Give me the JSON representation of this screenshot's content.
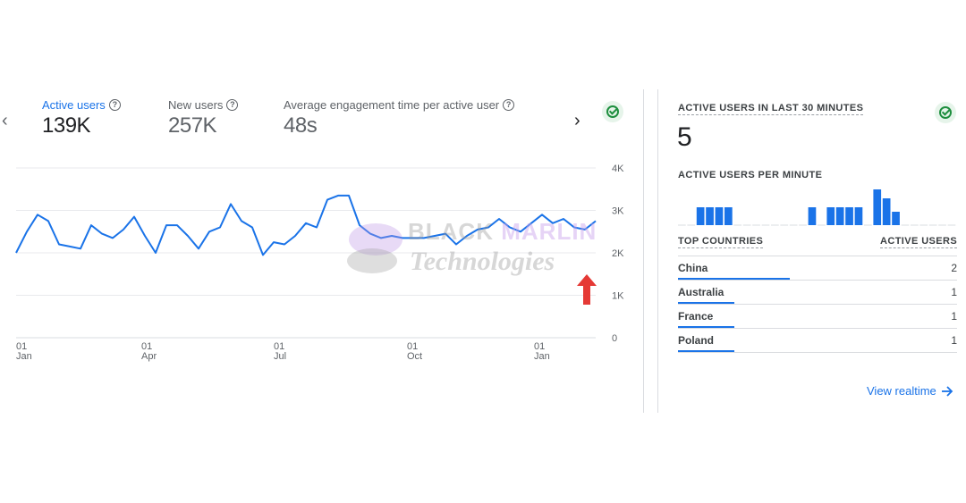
{
  "metrics": [
    {
      "label": "Active users",
      "value": "139K",
      "active": true
    },
    {
      "label": "New users",
      "value": "257K",
      "active": false
    },
    {
      "label": "Average engagement time per active user",
      "value": "48s",
      "active": false
    }
  ],
  "icons": {
    "help": "help-circle-icon",
    "status": "check-circle-icon",
    "prev": "chevron-left-icon",
    "next": "chevron-right-icon",
    "arrow": "arrow-up-icon",
    "link": "arrow-right-icon"
  },
  "colors": {
    "accent": "#1a73e8",
    "success": "#1e8e3e",
    "annotation_arrow": "#e53935"
  },
  "chart_data": {
    "type": "line",
    "y_ticks": [
      "4K",
      "3K",
      "2K",
      "1K",
      "0"
    ],
    "ylim": [
      0,
      4000
    ],
    "x_ticks": [
      {
        "day": "01",
        "month": "Jan"
      },
      {
        "day": "01",
        "month": "Apr"
      },
      {
        "day": "01",
        "month": "Jul"
      },
      {
        "day": "01",
        "month": "Oct"
      },
      {
        "day": "01",
        "month": "Jan"
      }
    ],
    "grid": true,
    "series": [
      {
        "values": [
          2000,
          2500,
          2900,
          2750,
          2200,
          2150,
          2100,
          2650,
          2450,
          2350,
          2550,
          2850,
          2400,
          2000,
          2650,
          2650,
          2400,
          2100,
          2500,
          2600,
          3150,
          2750,
          2600,
          1950,
          2250,
          2200,
          2400,
          2700,
          2600,
          3250,
          3350,
          3350,
          2650,
          2450,
          2350,
          2400,
          2350,
          2350,
          2350,
          2400,
          2450,
          2200,
          2400,
          2550,
          2600,
          2800,
          2600,
          2500,
          2700,
          2900,
          2700,
          2800,
          2600,
          2550,
          2750
        ]
      }
    ]
  },
  "realtime": {
    "title": "ACTIVE USERS IN LAST 30 MINUTES",
    "value": "5",
    "per_minute_label": "ACTIVE USERS PER MINUTE",
    "per_minute": [
      0,
      0,
      1,
      1,
      1,
      1,
      0,
      0,
      0,
      0,
      0,
      0,
      0,
      0,
      1,
      0,
      1,
      1,
      1,
      1,
      0,
      2,
      1.5,
      0.75,
      0,
      0,
      0,
      0,
      0,
      0
    ],
    "table_header_left": "TOP COUNTRIES",
    "table_header_right": "ACTIVE USERS",
    "countries": [
      {
        "name": "China",
        "value": "2",
        "share": 1.0
      },
      {
        "name": "Australia",
        "value": "1",
        "share": 0.5
      },
      {
        "name": "France",
        "value": "1",
        "share": 0.5
      },
      {
        "name": "Poland",
        "value": "1",
        "share": 0.5
      }
    ],
    "link_label": "View realtime"
  },
  "watermark": {
    "line1_a": "BLACK",
    "line1_b": "MARLIN",
    "line2": "Technologies"
  }
}
